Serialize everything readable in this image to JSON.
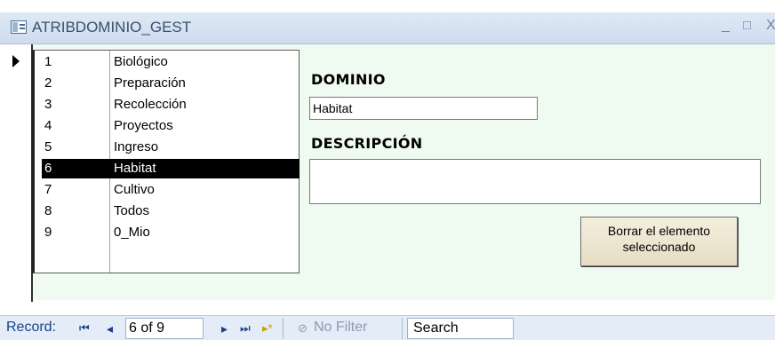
{
  "window": {
    "title": "ATRIBDOMINIO_GEST",
    "minimize_glyph": "_",
    "maximize_glyph": "□",
    "close_glyph": "X"
  },
  "list": {
    "rows": [
      {
        "id": "1",
        "name": "Biológico"
      },
      {
        "id": "2",
        "name": "Preparación"
      },
      {
        "id": "3",
        "name": "Recolección"
      },
      {
        "id": "4",
        "name": "Proyectos"
      },
      {
        "id": "5",
        "name": "Ingreso"
      },
      {
        "id": "6",
        "name": "Habitat"
      },
      {
        "id": "7",
        "name": "Cultivo"
      },
      {
        "id": "8",
        "name": "Todos"
      },
      {
        "id": "9",
        "name": "0_Mio"
      }
    ],
    "selected_index": 5
  },
  "form": {
    "dominio_label": "DOMINIO",
    "dominio_value": "Habitat",
    "descripcion_label": "DESCRIPCIÓN",
    "descripcion_value": "",
    "delete_button_line1": "Borrar el elemento",
    "delete_button_line2": "seleccionado"
  },
  "navigation": {
    "record_label": "Record:",
    "first_glyph": "⏮",
    "prev_glyph": "◂",
    "current_record": "6 of 9",
    "next_glyph": "▸",
    "last_glyph": "⏭",
    "new_glyph": "▸*",
    "filter_label": "No Filter",
    "search_label": "Search"
  },
  "colors": {
    "form_background": "#effbf0",
    "selected_row": "#000000",
    "nav_text": "#15428b"
  }
}
